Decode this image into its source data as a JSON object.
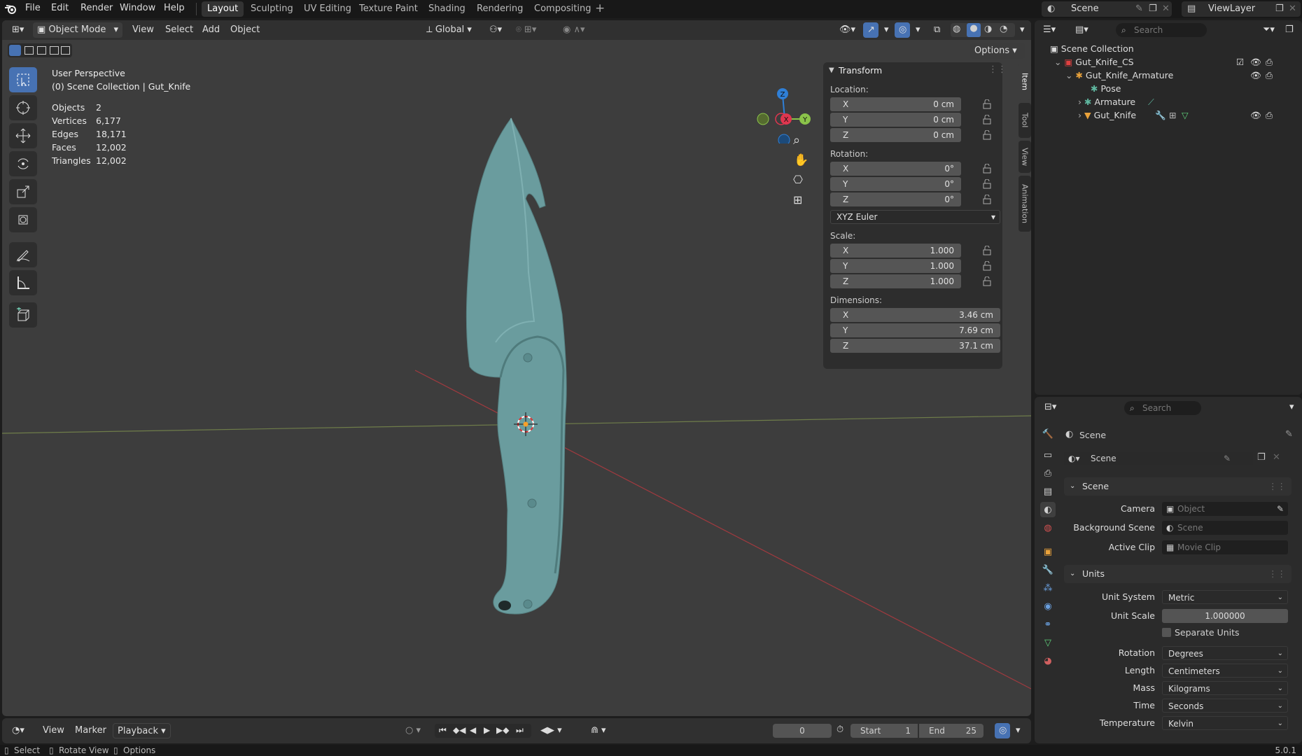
{
  "menu": {
    "file": "File",
    "edit": "Edit",
    "render": "Render",
    "window": "Window",
    "help": "Help"
  },
  "workspaces": [
    "Layout",
    "Sculpting",
    "UV Editing",
    "Texture Paint",
    "Shading",
    "Rendering",
    "Compositing"
  ],
  "scene_selector": "Scene",
  "view_layer": "ViewLayer",
  "viewport_header": {
    "mode": "Object Mode",
    "view": "View",
    "select": "Select",
    "add": "Add",
    "object": "Object",
    "orientation": "Global",
    "options": "Options"
  },
  "overlay_text": {
    "perspective": "User Perspective",
    "collection": "(0) Scene Collection | Gut_Knife"
  },
  "stats": [
    {
      "label": "Objects",
      "value": "2"
    },
    {
      "label": "Vertices",
      "value": "6,177"
    },
    {
      "label": "Edges",
      "value": "18,171"
    },
    {
      "label": "Faces",
      "value": "12,002"
    },
    {
      "label": "Triangles",
      "value": "12,002"
    }
  ],
  "gizmo": {
    "z": "Z",
    "x": "X",
    "y": "Y"
  },
  "transform": {
    "title": "Transform",
    "location_label": "Location:",
    "location": [
      {
        "axis": "X",
        "value": "0 cm"
      },
      {
        "axis": "Y",
        "value": "0 cm"
      },
      {
        "axis": "Z",
        "value": "0 cm"
      }
    ],
    "rotation_label": "Rotation:",
    "rotation": [
      {
        "axis": "X",
        "value": "0°"
      },
      {
        "axis": "Y",
        "value": "0°"
      },
      {
        "axis": "Z",
        "value": "0°"
      }
    ],
    "rotation_mode": "XYZ Euler",
    "scale_label": "Scale:",
    "scale": [
      {
        "axis": "X",
        "value": "1.000"
      },
      {
        "axis": "Y",
        "value": "1.000"
      },
      {
        "axis": "Z",
        "value": "1.000"
      }
    ],
    "dimensions_label": "Dimensions:",
    "dimensions": [
      {
        "axis": "X",
        "value": "3.46 cm"
      },
      {
        "axis": "Y",
        "value": "7.69 cm"
      },
      {
        "axis": "Z",
        "value": "37.1 cm"
      }
    ]
  },
  "sidebar_tabs": [
    "Item",
    "Tool",
    "View",
    "Animation"
  ],
  "timeline": {
    "view": "View",
    "marker": "Marker",
    "playback": "Playback",
    "current_frame": "0",
    "start_label": "Start",
    "start": "1",
    "end_label": "End",
    "end": "25"
  },
  "statusbar": {
    "select": "Select",
    "rotate": "Rotate View",
    "options": "Options",
    "version": "5.0.1"
  },
  "outliner": {
    "search_placeholder": "Search",
    "items": [
      {
        "label": "Scene Collection"
      },
      {
        "label": "Gut_Knife_CS"
      },
      {
        "label": "Gut_Knife_Armature"
      },
      {
        "label": "Pose"
      },
      {
        "label": "Armature"
      },
      {
        "label": "Gut_Knife"
      }
    ]
  },
  "properties": {
    "search_placeholder": "Search",
    "context": "Scene",
    "scene_name": "Scene",
    "scene_section": "Scene",
    "camera_label": "Camera",
    "camera_placeholder": "Object",
    "bg_label": "Background Scene",
    "bg_placeholder": "Scene",
    "clip_label": "Active Clip",
    "clip_placeholder": "Movie Clip",
    "units_section": "Units",
    "unit_system_label": "Unit System",
    "unit_system": "Metric",
    "unit_scale_label": "Unit Scale",
    "unit_scale": "1.000000",
    "separate_units": "Separate Units",
    "rotation_label": "Rotation",
    "rotation": "Degrees",
    "length_label": "Length",
    "length": "Centimeters",
    "mass_label": "Mass",
    "mass": "Kilograms",
    "time_label": "Time",
    "time": "Seconds",
    "temperature_label": "Temperature",
    "temperature": "Kelvin"
  },
  "colors": {
    "accent": "#4772b3",
    "knife": "#6a9c9e",
    "x_axis": "#e0364f",
    "y_axis": "#8bc34a",
    "z_axis": "#2f7fd6"
  }
}
